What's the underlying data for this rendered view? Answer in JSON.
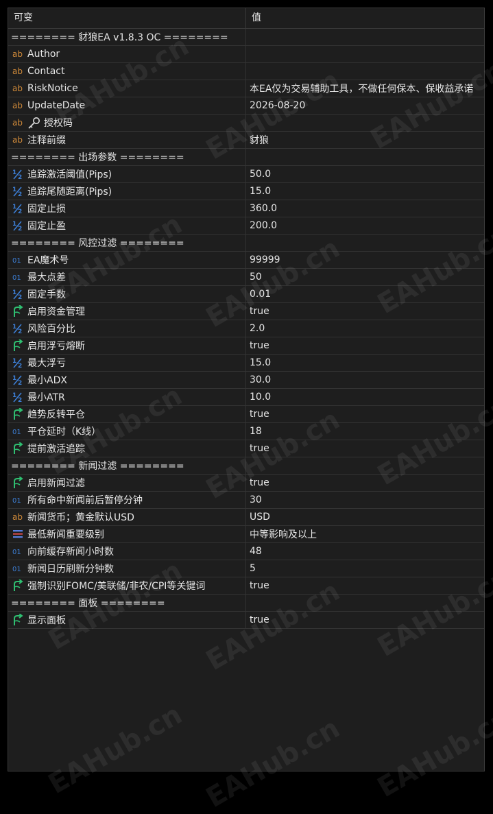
{
  "header": {
    "col_name": "可变",
    "col_value": "值"
  },
  "rows": [
    {
      "type": "sep",
      "name": "======== 豺狼EA v1.8.3 OC ========",
      "value": ""
    },
    {
      "type": "string",
      "name": "Author",
      "value": ""
    },
    {
      "type": "string",
      "name": "Contact",
      "value": ""
    },
    {
      "type": "string",
      "name": "RiskNotice",
      "value": "本EA仅为交易辅助工具，不做任何保本、保收益承诺"
    },
    {
      "type": "string",
      "name": "UpdateDate",
      "value": "2026-08-20"
    },
    {
      "type": "string",
      "name": "授权码",
      "value": "",
      "key": true
    },
    {
      "type": "string",
      "name": "注释前缀",
      "value": "豺狼"
    },
    {
      "type": "sep",
      "name": "======== 出场参数 ========",
      "value": ""
    },
    {
      "type": "double",
      "name": "追踪激活阈值(Pips)",
      "value": "50.0"
    },
    {
      "type": "double",
      "name": "追踪尾随距离(Pips)",
      "value": "15.0"
    },
    {
      "type": "double",
      "name": "固定止损",
      "value": "360.0"
    },
    {
      "type": "double",
      "name": "固定止盈",
      "value": "200.0"
    },
    {
      "type": "sep",
      "name": "======== 风控过滤 ========",
      "value": ""
    },
    {
      "type": "int",
      "name": "EA魔术号",
      "value": "99999"
    },
    {
      "type": "int",
      "name": "最大点差",
      "value": "50"
    },
    {
      "type": "double",
      "name": "固定手数",
      "value": "0.01"
    },
    {
      "type": "bool",
      "name": "启用资金管理",
      "value": "true"
    },
    {
      "type": "double",
      "name": "风险百分比",
      "value": "2.0"
    },
    {
      "type": "bool",
      "name": "启用浮亏熔断",
      "value": "true"
    },
    {
      "type": "double",
      "name": "最大浮亏",
      "value": "15.0"
    },
    {
      "type": "double",
      "name": "最小ADX",
      "value": "30.0"
    },
    {
      "type": "double",
      "name": "最小ATR",
      "value": "10.0"
    },
    {
      "type": "bool",
      "name": "趋势反转平仓",
      "value": "true"
    },
    {
      "type": "int",
      "name": "平仓延时（K线）",
      "value": "18"
    },
    {
      "type": "bool",
      "name": "提前激活追踪",
      "value": "true"
    },
    {
      "type": "sep",
      "name": "======== 新闻过滤 ========",
      "value": ""
    },
    {
      "type": "bool",
      "name": "启用新闻过滤",
      "value": "true"
    },
    {
      "type": "int",
      "name": "所有命中新闻前后暂停分钟",
      "value": "30"
    },
    {
      "type": "string",
      "name": "新闻货币；黄金默认USD",
      "value": "USD"
    },
    {
      "type": "enum",
      "name": "最低新闻重要级别",
      "value": "中等影响及以上"
    },
    {
      "type": "int",
      "name": "向前缓存新闻小时数",
      "value": "48"
    },
    {
      "type": "int",
      "name": "新闻日历刷新分钟数",
      "value": "5"
    },
    {
      "type": "bool",
      "name": "强制识别FOMC/美联储/非农/CPI等关键词",
      "value": "true"
    },
    {
      "type": "sep",
      "name": "======== 面板 ========",
      "value": ""
    },
    {
      "type": "bool",
      "name": "显示面板",
      "value": "true"
    }
  ],
  "watermark": "EAHub.cn",
  "colors": {
    "background": "#1e1e1e",
    "string_icon": "#d08a3a",
    "double_icon": "#3d7fd6",
    "int_icon": "#3d7fd6",
    "bool_icon": "#2fbf71",
    "enum_icon": "#5a7fe0"
  }
}
